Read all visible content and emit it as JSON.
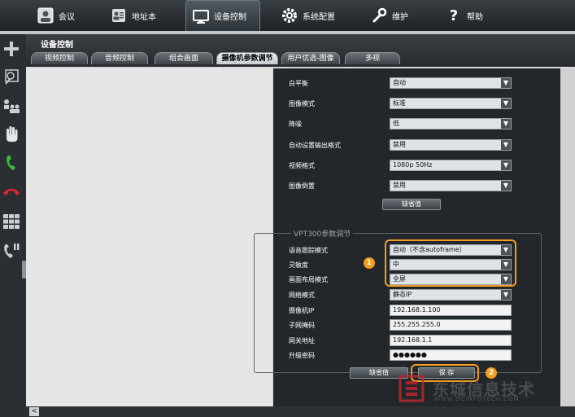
{
  "topnav": {
    "items": [
      {
        "label": "会议",
        "icon": "meeting-icon"
      },
      {
        "label": "地址本",
        "icon": "address-book-icon"
      },
      {
        "label": "设备控制",
        "icon": "monitor-icon"
      },
      {
        "label": "系统配置",
        "icon": "gear-icon"
      },
      {
        "label": "维护",
        "icon": "wrench-icon"
      },
      {
        "label": "帮助",
        "icon": "help-icon"
      }
    ],
    "active_index": 2
  },
  "sidebar": {
    "icons": [
      "plus-icon",
      "camera-search-icon",
      "participants-icon",
      "hand-icon",
      "call-green-icon",
      "hangup-red-icon",
      "grid-icon",
      "phone-pause-icon"
    ]
  },
  "page": {
    "title": "设备控制",
    "tabs": [
      "视频控制",
      "音频控制",
      "组合画面",
      "摄像机参数调节",
      "用户优选-图像",
      "多视"
    ],
    "active_tab": 3
  },
  "image_settings": {
    "rows": [
      {
        "label": "白平衡",
        "value": "自动"
      },
      {
        "label": "图像模式",
        "value": "标准"
      },
      {
        "label": "降噪",
        "value": "低"
      },
      {
        "label": "自动设置输出格式",
        "value": "禁用"
      },
      {
        "label": "视频格式",
        "value": "1080p 50Hz"
      },
      {
        "label": "图像倒置",
        "value": "禁用"
      }
    ],
    "default_button": "缺省值"
  },
  "vpt300": {
    "title": "VPT300参数调节",
    "rows": [
      {
        "label": "语音跟踪模式",
        "value": "自动（不含autoframe）",
        "type": "select"
      },
      {
        "label": "灵敏度",
        "value": "中",
        "type": "select"
      },
      {
        "label": "画面布局模式",
        "value": "全屏",
        "type": "select"
      },
      {
        "label": "网络模式",
        "value": "静态IP",
        "type": "select"
      },
      {
        "label": "摄像机IP",
        "value": "192.168.1.100",
        "type": "input"
      },
      {
        "label": "子网掩码",
        "value": "255.255.255.0",
        "type": "input"
      },
      {
        "label": "网关地址",
        "value": "192.168.1.1",
        "type": "input"
      },
      {
        "label": "升级密码",
        "value": "●●●●●●",
        "type": "input"
      }
    ],
    "default_button": "缺省值",
    "save_button": "保 存"
  },
  "annotations": {
    "badge1": "1",
    "badge2": "2"
  },
  "watermark": {
    "cn": "东城信息技术",
    "en": "WWW.DCINFOTECH.COM"
  },
  "colors": {
    "highlight": "#f29e1f",
    "panel": "#23272b"
  }
}
